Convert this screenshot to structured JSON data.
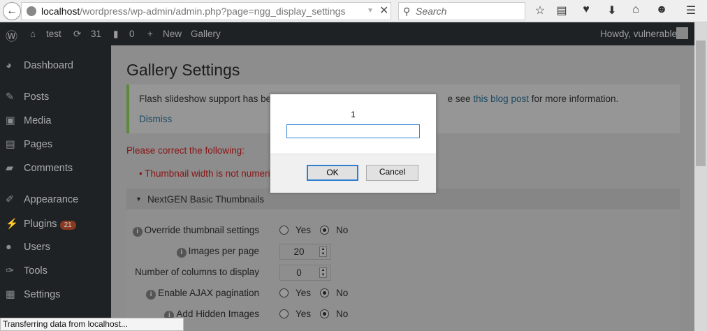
{
  "browser": {
    "url_host": "localhost",
    "url_path": "/wordpress/wp-admin/admin.php?page=ngg_display_settings",
    "search_placeholder": "Search",
    "status": "Transferring data from localhost..."
  },
  "adminbar": {
    "site": "test",
    "updates": "31",
    "comments": "0",
    "new": "New",
    "gallery": "Gallery",
    "howdy": "Howdy, vulnerable"
  },
  "sidebar": {
    "items": [
      {
        "label": "Dashboard",
        "icon": "dashboard-icon",
        "glyph": "◕"
      },
      {
        "label": "Posts",
        "icon": "pin-icon",
        "glyph": "✎"
      },
      {
        "label": "Media",
        "icon": "media-icon",
        "glyph": "▣"
      },
      {
        "label": "Pages",
        "icon": "pages-icon",
        "glyph": "▤"
      },
      {
        "label": "Comments",
        "icon": "comment-icon",
        "glyph": "▰"
      },
      {
        "label": "Appearance",
        "icon": "brush-icon",
        "glyph": "✐"
      },
      {
        "label": "Plugins",
        "icon": "plugin-icon",
        "glyph": "⚡",
        "badge": "21"
      },
      {
        "label": "Users",
        "icon": "users-icon",
        "glyph": "●"
      },
      {
        "label": "Tools",
        "icon": "wrench-icon",
        "glyph": "✑"
      },
      {
        "label": "Settings",
        "icon": "settings-icon",
        "glyph": "▦"
      }
    ]
  },
  "main": {
    "title": "Gallery Settings",
    "notice_start": "Flash slideshow support has bee",
    "notice_mid": "e see ",
    "notice_link": "this blog post",
    "notice_end": " for more information.",
    "dismiss": "Dismiss",
    "error_title": "Please correct the following:",
    "error_item": "Thumbnail width is not numeric",
    "section": "NextGEN Basic Thumbnails",
    "yes": "Yes",
    "no": "No",
    "rows": {
      "override": "Override thumbnail settings",
      "images_per_page": "Images per page",
      "images_per_page_value": "20",
      "columns": "Number of columns to display",
      "columns_value": "0",
      "ajax": "Enable AJAX pagination",
      "hidden": "Add Hidden Images"
    }
  },
  "dialog": {
    "message": "1",
    "input_value": "",
    "ok": "OK",
    "cancel": "Cancel"
  }
}
